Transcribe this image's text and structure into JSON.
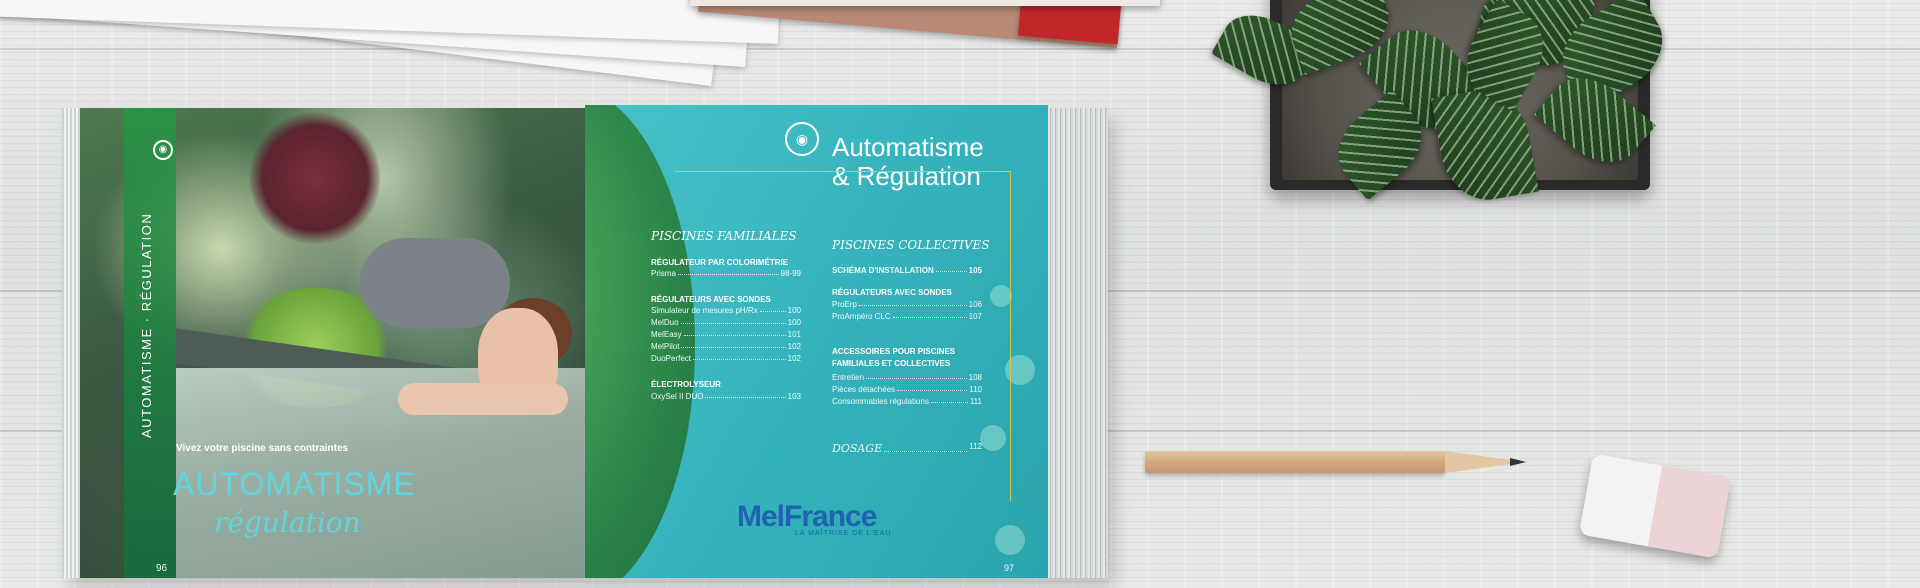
{
  "book": {
    "left_page": {
      "vertical_title": "AUTOMATISME · RÉGULATION",
      "subtitle": "Vivez votre piscine sans contraintes",
      "title": "AUTOMATISME",
      "script_title": "régulation",
      "page_number": "96"
    },
    "right_page": {
      "title_line1": "Automatisme",
      "title_line2": "& Régulation",
      "page_number": "97",
      "left_column": {
        "heading": "PISCINES FAMILIALES",
        "groups": [
          {
            "title": "RÉGULATEUR PAR COLORIMÉTRIE",
            "items": [
              {
                "label": "Prisma",
                "page": "98-99"
              }
            ]
          },
          {
            "title": "RÉGULATEURS AVEC SONDES",
            "items": [
              {
                "label": "Simulateur de mesures pH/Rx",
                "page": "100"
              },
              {
                "label": "MelDuo",
                "page": "100"
              },
              {
                "label": "MelEasy",
                "page": "101"
              },
              {
                "label": "MelPilot",
                "page": "102"
              },
              {
                "label": "DuoPerfect",
                "page": "102"
              }
            ]
          },
          {
            "title": "ÉLECTROLYSEUR",
            "items": [
              {
                "label": "OxySel II DUO",
                "page": "103"
              }
            ]
          }
        ]
      },
      "right_column": {
        "heading": "PISCINES COLLECTIVES",
        "groups": [
          {
            "title": "SCHÉMA D'INSTALLATION",
            "page": "105",
            "items": []
          },
          {
            "title": "RÉGULATEURS AVEC SONDES",
            "items": [
              {
                "label": "ProErp",
                "page": "106"
              },
              {
                "label": "ProAmpéro CLC",
                "page": "107"
              }
            ]
          },
          {
            "title_line1": "ACCESSOIRES POUR PISCINES",
            "title_line2": "FAMILIALES ET COLLECTIVES",
            "items": [
              {
                "label": "Entretien",
                "page": "108"
              },
              {
                "label": "Pièces détachées",
                "page": "110"
              },
              {
                "label": "Consommables régulations",
                "page": "111"
              }
            ]
          }
        ],
        "dosage": {
          "label": "DOSAGE",
          "page": "112"
        }
      },
      "logo": {
        "brand": "MelFrance",
        "tagline": "LA MAÎTRISE DE L'EAU"
      }
    }
  },
  "colors": {
    "teal": "#3cb8c0",
    "gold_rule": "#d9c24a",
    "logo_blue": "#1e62b0",
    "logo_yellow": "#f2c21d"
  }
}
